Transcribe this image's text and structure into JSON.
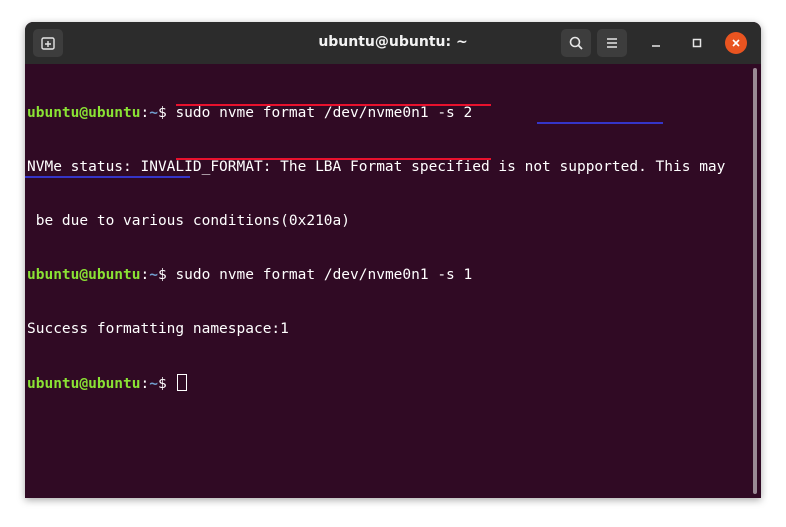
{
  "window": {
    "title": "ubuntu@ubuntu: ~"
  },
  "icons": {
    "new_tab": "new-tab-icon",
    "search": "search-icon",
    "menu": "hamburger-menu-icon",
    "minimize": "minimize-icon",
    "maximize": "maximize-icon",
    "close": "close-icon"
  },
  "colors": {
    "terminal_bg": "#300a24",
    "prompt_user": "#8ae234",
    "prompt_path": "#729fcf",
    "close_button": "#e95420",
    "annotation_red": "#e8112d",
    "annotation_blue": "#3535c8"
  },
  "terminal": {
    "prompt_user": "ubuntu@ubuntu",
    "prompt_sep": ":",
    "prompt_path": "~",
    "prompt_symbol": "$ ",
    "command_1": "sudo nvme format /dev/nvme0n1 -s 2",
    "output_1_line_1": "NVMe status: INVALID_FORMAT: The LBA Format specified is not supported. This may",
    "output_1_line_2": " be due to various conditions(0x210a)",
    "command_2": "sudo nvme format /dev/nvme0n1 -s 1",
    "output_2": "Success formatting namespace:1"
  }
}
